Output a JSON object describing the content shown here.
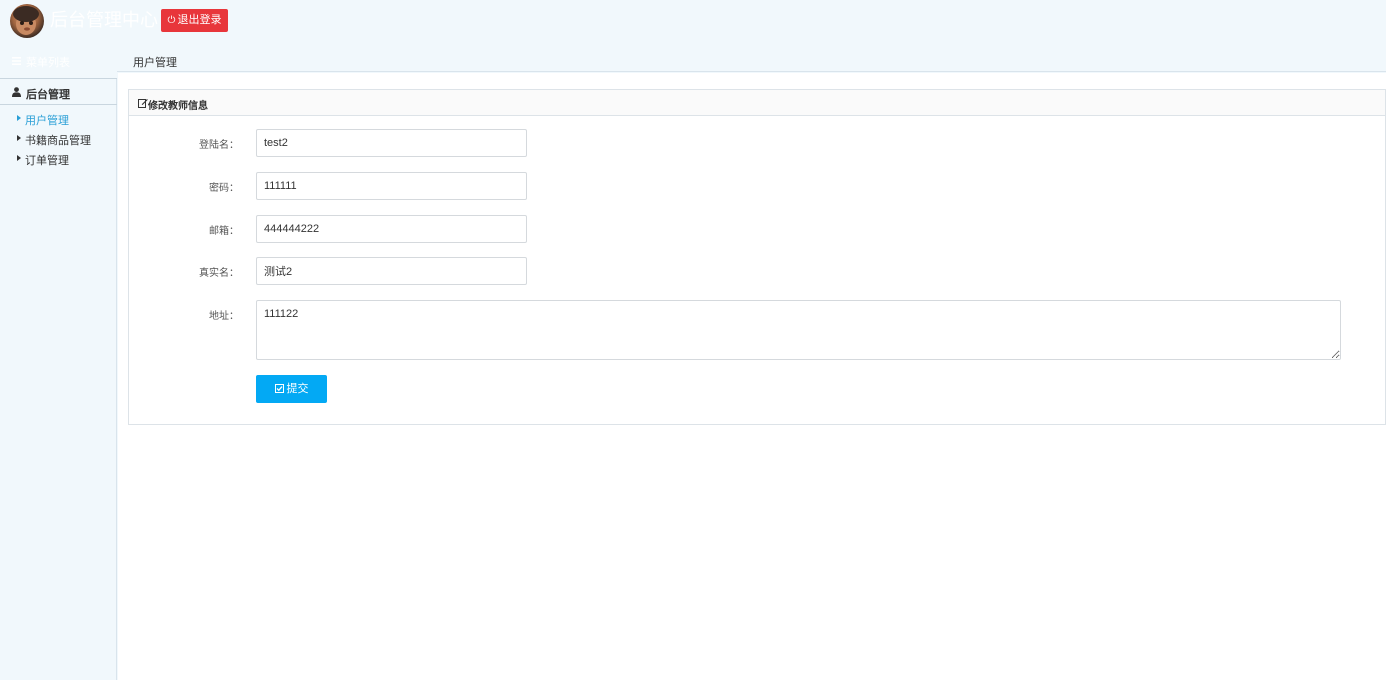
{
  "header": {
    "title": "后台管理中心",
    "logout_label": "退出登录"
  },
  "sidebar": {
    "menu_label": "菜单列表",
    "section_label": "后台管理",
    "items": [
      {
        "label": "用户管理",
        "active": true
      },
      {
        "label": "书籍商品管理",
        "active": false
      },
      {
        "label": "订单管理",
        "active": false
      }
    ]
  },
  "breadcrumb": {
    "current": "用户管理"
  },
  "panel": {
    "title": "修改教师信息"
  },
  "form": {
    "username": {
      "label": "登陆名：",
      "value": "test2"
    },
    "password": {
      "label": "密码：",
      "value": "111111"
    },
    "email": {
      "label": "邮箱：",
      "value": "444444222"
    },
    "realname": {
      "label": "真实名：",
      "value": "测试2"
    },
    "address": {
      "label": "地址：",
      "value": "111122"
    },
    "submit_label": "提交"
  },
  "colors": {
    "logout": "#e8363b",
    "submit": "#03a9f4",
    "active_nav": "#2a9fd6",
    "page_bg": "#f1f8fc"
  }
}
